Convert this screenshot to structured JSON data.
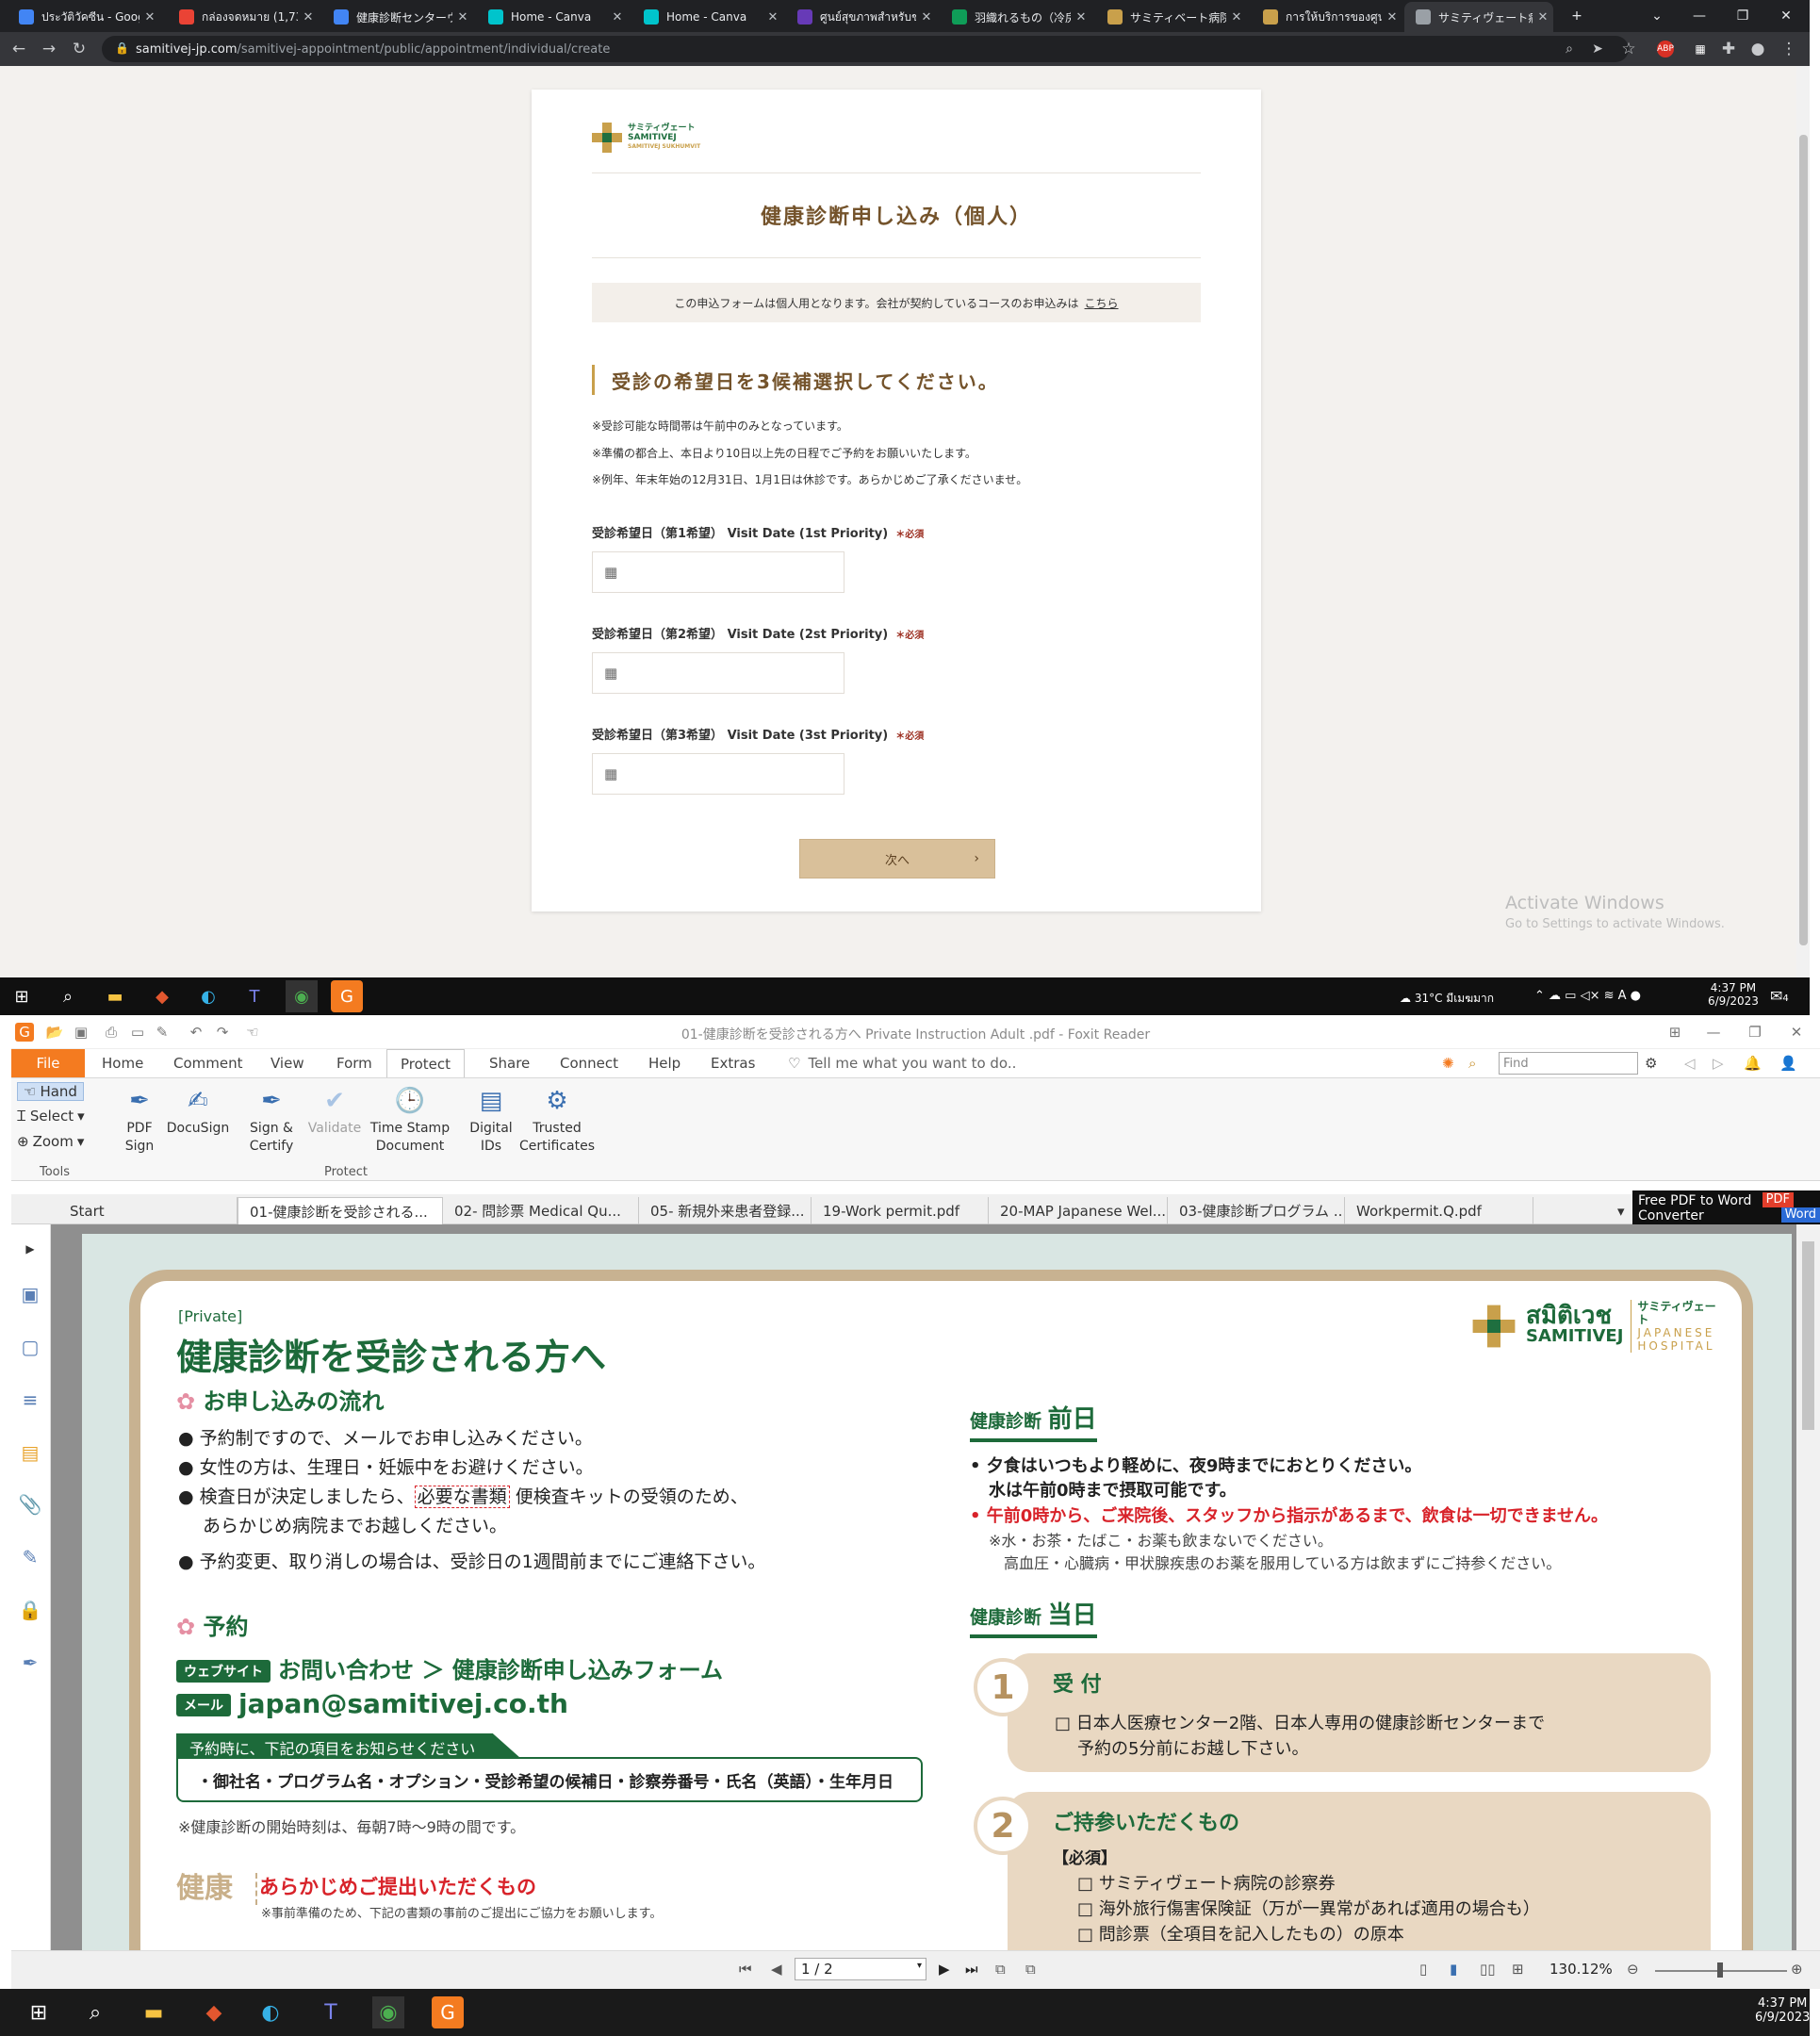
{
  "browser": {
    "tabs": [
      {
        "label": "ประวัติวัคซีน - Googl",
        "icon": "google-icon",
        "color": "#4285f4"
      },
      {
        "label": "กล่องจดหมาย (1,732",
        "icon": "gmail-icon",
        "color": "#ea4335"
      },
      {
        "label": "健康診断センターウ",
        "icon": "docs-icon",
        "color": "#4285f4"
      },
      {
        "label": "Home - Canva",
        "icon": "canva-icon",
        "color": "#00c4cc"
      },
      {
        "label": "Home - Canva",
        "icon": "canva-icon",
        "color": "#00c4cc"
      },
      {
        "label": "ศูนย์สุขภาพสำหรับชา",
        "icon": "forms-icon",
        "color": "#673ab7"
      },
      {
        "label": "羽織れるもの（冷房",
        "icon": "sheets-icon",
        "color": "#0f9d58"
      },
      {
        "label": "サミティベート病院スク",
        "icon": "hospital-cross-icon",
        "color": "#c9a04b"
      },
      {
        "label": "การให้บริการของศูนย์",
        "icon": "hospital-cross-icon",
        "color": "#c9a04b"
      },
      {
        "label": "サミティヴェート病院 ス",
        "icon": "globe-icon",
        "color": "#9aa0a6"
      }
    ],
    "url_host": "samitivej-jp.com",
    "url_path": "/samitivej-appointment/public/appointment/individual/create",
    "activate_windows": {
      "line1": "Activate Windows",
      "line2": "Go to Settings to activate Windows."
    }
  },
  "form": {
    "logo_jp": "サミティヴェート",
    "logo_en": "SAMITIVEJ",
    "logo_sub": "SAMITIVEJ SUKHUMVIT",
    "title": "健康診断申し込み（個人）",
    "notice": "この申込フォームは個人用となります。会社が契約しているコースのお申込みは",
    "notice_link": "こちら",
    "section_heading": "受診の希望日を3候補選択してください。",
    "notes": [
      "※受診可能な時間帯は午前中のみとなっています。",
      "※準備の都合上、本日より10日以上先の日程でご予約をお願いいたします。",
      "※例年、年末年始の12月31日、1月1日は休診です。あらかじめご了承くださいませ。"
    ],
    "fields": [
      {
        "label": "受診希望日（第1希望） Visit Date (1st Priority)",
        "required": "＊必須",
        "value": ""
      },
      {
        "label": "受診希望日（第2希望） Visit Date (2st Priority)",
        "required": "＊必須",
        "value": ""
      },
      {
        "label": "受診希望日（第3希望） Visit Date (3st Priority)",
        "required": "＊必須",
        "value": ""
      }
    ],
    "next_button": "次へ"
  },
  "taskbar_top": {
    "weather": "31°C มีเมฆมาก",
    "time": "4:37 PM",
    "date": "6/9/2023",
    "notifications": "4"
  },
  "foxit": {
    "title": "01-健康診断を受診される方へ Private Instruction Adult .pdf - Foxit Reader",
    "menu": [
      "File",
      "Home",
      "Comment",
      "View",
      "Form",
      "Protect",
      "Share",
      "Connect",
      "Help",
      "Extras"
    ],
    "tell_me": "Tell me what you want to do..",
    "find_placeholder": "Find",
    "tools": [
      "Hand",
      "Select",
      "Zoom"
    ],
    "tools_group": "Tools",
    "protect_buttons": [
      {
        "label": "PDF Sign",
        "icon": "pdf-sign-icon"
      },
      {
        "label": "DocuSign",
        "icon": "docusign-icon"
      },
      {
        "label": "Sign & Certify",
        "icon": "sign-certify-icon"
      },
      {
        "label": "Validate",
        "icon": "validate-icon"
      },
      {
        "label": "Time Stamp Document",
        "icon": "time-stamp-icon"
      },
      {
        "label": "Digital IDs",
        "icon": "digital-ids-icon"
      },
      {
        "label": "Trusted Certificates",
        "icon": "trusted-certificates-icon"
      }
    ],
    "protect_group": "Protect",
    "doc_tabs": [
      "Start",
      "01-健康診断を受診される...",
      "02- 問診票 Medical Qu...",
      "05- 新規外来患者登録...",
      "19-Work permit.pdf",
      "20-MAP Japanese Wel...",
      "03-健康診断プログラム ...",
      "Workpermit.Q.pdf"
    ],
    "ad": {
      "line1": "Free PDF to Word",
      "line2": "Converter",
      "badge1": "PDF",
      "badge2": "Word"
    },
    "page_field": "1 / 2",
    "zoom": "130.12%"
  },
  "pdf": {
    "tag": "[Private]",
    "title": "健康診断を受診される方へ",
    "logo_th": "สมิติเวช",
    "logo_en": "SAMITIVEJ",
    "logo_jp": "サミティヴェート",
    "logo_sub": "JAPANESE HOSPITAL",
    "flow_heading": "お申し込みの流れ",
    "flow_items": [
      "予約制ですので、メールでお申し込みください。",
      "女性の方は、生理日・妊娠中をお避けください。",
      "検査日が決定しましたら、",
      "あらかじめ病院までお越しください。",
      "予約変更、取り消しの場合は、受診日の1週間前までにご連絡下さい。"
    ],
    "flow_item3_box": "必要な書類",
    "flow_item3_rest": "便検査キットの受領のため、",
    "reserve_heading": "予約",
    "website_pill": "ウェブサイト",
    "website_text": "お問い合わせ ＞ 健康診断申し込みフォーム",
    "mail_pill": "メール",
    "mail_text": "japan@samitivej.co.th",
    "inform_heading": "予約時に、下記の項目をお知らせください",
    "inform_items": "・御社名・プログラム名・オプション・受診希望の候補日・診察券番号・氏名（英語）・生年月日",
    "start_note": "※健康診断の開始時刻は、毎朝7時〜9時の間です。",
    "vertical_label": "健康",
    "submit_heading": "あらかじめご提出いただくもの",
    "submit_note": "※事前準備のため、下記の書類の事前のご提出にご協力をお願いします。",
    "day_before_head_small": "健康診断",
    "day_before_head_big": "前日",
    "day_before": [
      "• 夕食はいつもより軽めに、夜9時までにおとりください。",
      "水は午前0時まで摂取可能です。",
      "• 午前0時から、ご来院後、スタッフから指示があるまで、飲食は一切できません。",
      "※水・お茶・たばこ・お薬も飲まないでください。",
      "高血圧・心臓病・甲状腺疾患のお薬を服用している方は飲まずにご持参ください。"
    ],
    "day_of_head_small": "健康診断",
    "day_of_head_big": "当日",
    "step1_num": "1",
    "step1_title": "受 付",
    "step1_text1": "□ 日本人医療センター2階、日本人専用の健康診断センターまで",
    "step1_text2": "予約の5分前にお越し下さい。",
    "step2_num": "2",
    "step2_title": "ご持参いただくもの",
    "step2_required": "【必須】",
    "step2_items": [
      "□ サミティヴェート病院の診察券",
      "□ 海外旅行傷害保険証（万が一異常があれば適用の場合も）",
      "□ 問診票（全項目を記入したもの）の原本"
    ]
  },
  "taskbar_bottom": {
    "time": "4:37 PM",
    "date": "6/9/2023"
  }
}
